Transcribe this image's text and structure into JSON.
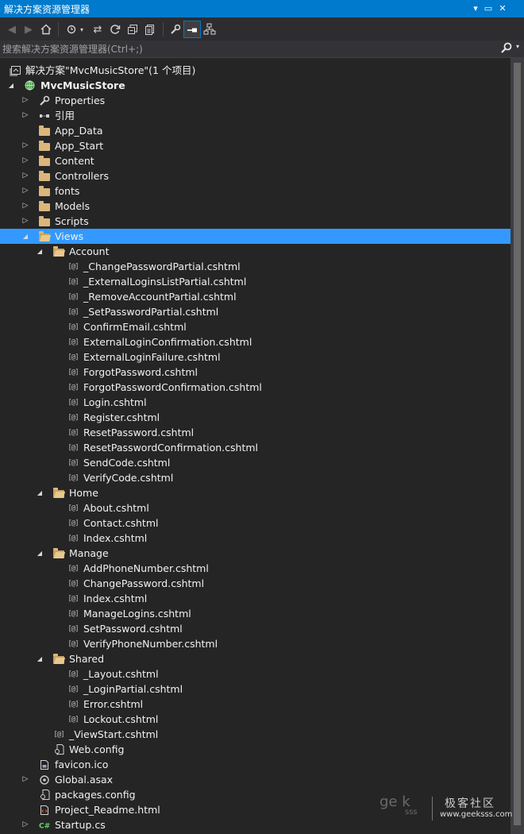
{
  "window": {
    "title": "解决方案资源管理器"
  },
  "search": {
    "placeholder": "搜索解决方案资源管理器(Ctrl+;)"
  },
  "tree": [
    {
      "label": "解决方案\"MvcMusicStore\"(1 个项目)",
      "level": 0,
      "twisty": "none",
      "icon": "solution-icon"
    },
    {
      "label": "MvcMusicStore",
      "level": 0,
      "twisty": "expanded",
      "icon": "web-project-icon",
      "bold": true
    },
    {
      "label": "Properties",
      "level": 1,
      "twisty": "collapsed",
      "icon": "wrench-icon"
    },
    {
      "label": "引用",
      "level": 1,
      "twisty": "collapsed",
      "icon": "references-icon"
    },
    {
      "label": "App_Data",
      "level": 1,
      "twisty": "none",
      "icon": "folder-icon"
    },
    {
      "label": "App_Start",
      "level": 1,
      "twisty": "collapsed",
      "icon": "folder-icon"
    },
    {
      "label": "Content",
      "level": 1,
      "twisty": "collapsed",
      "icon": "folder-icon"
    },
    {
      "label": "Controllers",
      "level": 1,
      "twisty": "collapsed",
      "icon": "folder-icon"
    },
    {
      "label": "fonts",
      "level": 1,
      "twisty": "collapsed",
      "icon": "folder-icon"
    },
    {
      "label": "Models",
      "level": 1,
      "twisty": "collapsed",
      "icon": "folder-icon"
    },
    {
      "label": "Scripts",
      "level": 1,
      "twisty": "collapsed",
      "icon": "folder-icon"
    },
    {
      "label": "Views",
      "level": 1,
      "twisty": "expanded",
      "icon": "folder-open-icon",
      "selected": true
    },
    {
      "label": "Account",
      "level": 2,
      "twisty": "expanded",
      "icon": "folder-open-icon"
    },
    {
      "label": "_ChangePasswordPartial.cshtml",
      "level": 3,
      "twisty": "none",
      "icon": "cshtml-icon"
    },
    {
      "label": "_ExternalLoginsListPartial.cshtml",
      "level": 3,
      "twisty": "none",
      "icon": "cshtml-icon"
    },
    {
      "label": "_RemoveAccountPartial.cshtml",
      "level": 3,
      "twisty": "none",
      "icon": "cshtml-icon"
    },
    {
      "label": "_SetPasswordPartial.cshtml",
      "level": 3,
      "twisty": "none",
      "icon": "cshtml-icon"
    },
    {
      "label": "ConfirmEmail.cshtml",
      "level": 3,
      "twisty": "none",
      "icon": "cshtml-icon"
    },
    {
      "label": "ExternalLoginConfirmation.cshtml",
      "level": 3,
      "twisty": "none",
      "icon": "cshtml-icon"
    },
    {
      "label": "ExternalLoginFailure.cshtml",
      "level": 3,
      "twisty": "none",
      "icon": "cshtml-icon"
    },
    {
      "label": "ForgotPassword.cshtml",
      "level": 3,
      "twisty": "none",
      "icon": "cshtml-icon"
    },
    {
      "label": "ForgotPasswordConfirmation.cshtml",
      "level": 3,
      "twisty": "none",
      "icon": "cshtml-icon"
    },
    {
      "label": "Login.cshtml",
      "level": 3,
      "twisty": "none",
      "icon": "cshtml-icon"
    },
    {
      "label": "Register.cshtml",
      "level": 3,
      "twisty": "none",
      "icon": "cshtml-icon"
    },
    {
      "label": "ResetPassword.cshtml",
      "level": 3,
      "twisty": "none",
      "icon": "cshtml-icon"
    },
    {
      "label": "ResetPasswordConfirmation.cshtml",
      "level": 3,
      "twisty": "none",
      "icon": "cshtml-icon"
    },
    {
      "label": "SendCode.cshtml",
      "level": 3,
      "twisty": "none",
      "icon": "cshtml-icon"
    },
    {
      "label": "VerifyCode.cshtml",
      "level": 3,
      "twisty": "none",
      "icon": "cshtml-icon"
    },
    {
      "label": "Home",
      "level": 2,
      "twisty": "expanded",
      "icon": "folder-open-icon"
    },
    {
      "label": "About.cshtml",
      "level": 3,
      "twisty": "none",
      "icon": "cshtml-icon"
    },
    {
      "label": "Contact.cshtml",
      "level": 3,
      "twisty": "none",
      "icon": "cshtml-icon"
    },
    {
      "label": "Index.cshtml",
      "level": 3,
      "twisty": "none",
      "icon": "cshtml-icon"
    },
    {
      "label": "Manage",
      "level": 2,
      "twisty": "expanded",
      "icon": "folder-open-icon"
    },
    {
      "label": "AddPhoneNumber.cshtml",
      "level": 3,
      "twisty": "none",
      "icon": "cshtml-icon"
    },
    {
      "label": "ChangePassword.cshtml",
      "level": 3,
      "twisty": "none",
      "icon": "cshtml-icon"
    },
    {
      "label": "Index.cshtml",
      "level": 3,
      "twisty": "none",
      "icon": "cshtml-icon"
    },
    {
      "label": "ManageLogins.cshtml",
      "level": 3,
      "twisty": "none",
      "icon": "cshtml-icon"
    },
    {
      "label": "SetPassword.cshtml",
      "level": 3,
      "twisty": "none",
      "icon": "cshtml-icon"
    },
    {
      "label": "VerifyPhoneNumber.cshtml",
      "level": 3,
      "twisty": "none",
      "icon": "cshtml-icon"
    },
    {
      "label": "Shared",
      "level": 2,
      "twisty": "expanded",
      "icon": "folder-open-icon"
    },
    {
      "label": "_Layout.cshtml",
      "level": 3,
      "twisty": "none",
      "icon": "cshtml-icon"
    },
    {
      "label": "_LoginPartial.cshtml",
      "level": 3,
      "twisty": "none",
      "icon": "cshtml-icon"
    },
    {
      "label": "Error.cshtml",
      "level": 3,
      "twisty": "none",
      "icon": "cshtml-icon"
    },
    {
      "label": "Lockout.cshtml",
      "level": 3,
      "twisty": "none",
      "icon": "cshtml-icon"
    },
    {
      "label": "_ViewStart.cshtml",
      "level": 2,
      "twisty": "none",
      "icon": "cshtml-icon"
    },
    {
      "label": "Web.config",
      "level": 2,
      "twisty": "none",
      "icon": "config-icon"
    },
    {
      "label": "favicon.ico",
      "level": 1,
      "twisty": "none",
      "icon": "image-file-icon"
    },
    {
      "label": "Global.asax",
      "level": 1,
      "twisty": "collapsed",
      "icon": "global-asax-icon"
    },
    {
      "label": "packages.config",
      "level": 1,
      "twisty": "none",
      "icon": "config-icon"
    },
    {
      "label": "Project_Readme.html",
      "level": 1,
      "twisty": "none",
      "icon": "html-file-icon"
    },
    {
      "label": "Startup.cs",
      "level": 1,
      "twisty": "collapsed",
      "icon": "csharp-file-icon"
    }
  ],
  "watermark": {
    "logo_text": "ge  k",
    "logo_sub": "sss",
    "name": "极客社区",
    "url": "www.geeksss.com"
  },
  "colors": {
    "accent": "#007acc",
    "selection": "#3399ff",
    "background": "#252526"
  }
}
